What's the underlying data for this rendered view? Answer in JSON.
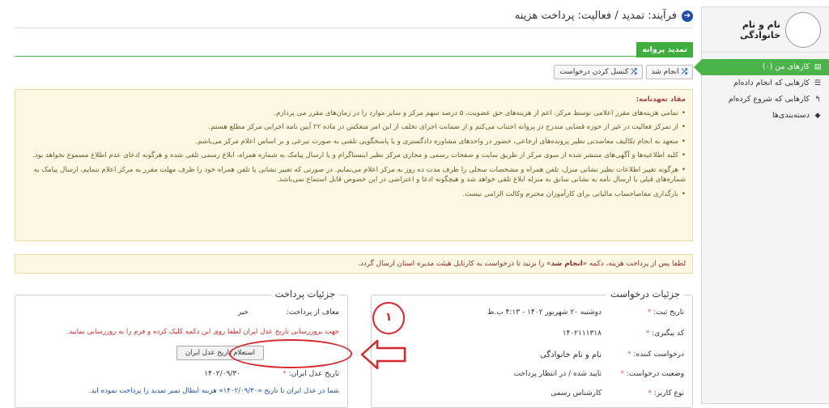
{
  "sidebar": {
    "profile_name": "نام و نام خانوادگی",
    "items": [
      {
        "label": "کارهای من (۰)",
        "icon": "inbox-icon",
        "glyph": "▤"
      },
      {
        "label": "کارهایی که انجام داده‌ام",
        "icon": "list-icon",
        "glyph": "☰"
      },
      {
        "label": "کارهایی که شروع کرده‌ام",
        "icon": "reply-icon",
        "glyph": "↰"
      },
      {
        "label": "دسته‌بندی‌ها",
        "icon": "tag-icon",
        "glyph": "◆"
      }
    ]
  },
  "header": {
    "title": "فرآیند: تمدید / فعالیت: پرداخت هزینه",
    "arrow_glyph": "➔"
  },
  "tab": {
    "label": "تمدید پروانه"
  },
  "toolbar": {
    "done_label": "انجام شد",
    "cancel_label": "کنسل کردن درخواست",
    "icon_glyph": "⤮"
  },
  "commitment": {
    "heading": "مفاد تعهدنامه:",
    "items": [
      "تمامی هزینه‌های مقرر اعلامی توسط مرکز، اعم از هزینه‌های حق عضویت، ۵ درصد سهم مرکز و سایر موارد را در زمان‌های مقرر می پردازم.",
      "از تمرکز فعالیت در غیر از حوزه قضایی مندرج در پروانه اجتناب می‌کنم و از ضمانت اجرای تخلف از این امر منعکس در ماده ۲۲ آیین نامه اجرایی مرکز مطلع هستم.",
      "متعهد به انجام تکالیف معاضدتی نظیر پرونده‌های ارجاعی، حضور در واحدهای مشاوره دادگستری و یا پاسخگویی تلفنی به صورت تبرعی و بر اساس اعلام مرکز می‌باشم.",
      "کلیه اطلاعیه‌ها و آگهی‌های منتشر شده از سوی مرکز از طریق سایت و صفحات رسمی و مجازی مرکز نظیر اینستاگرام و یا ارسال پیامک به شماره همراه، ابلاغ رسمی تلقی شده و هرگونه ادعای عدم اطلاع مسموع نخواهد بود.",
      "هرگونه تغییر اطلاعات نظیر نشانی منزل، تلفن همراه و مشخصات سجلی را ظرف مدت ده روز به مرکز اعلام می‌نمایم. در صورتی که تغییر نشانی یا تلفن همراه خود را ظرف مهلت مقرر به مرکز اعلام ننمایم، ارسال پیامک به شماره‌های قبلی یا ارسال نامه به نشانی سابق به منزله ابلاغ تلقی خواهد شد و هیچگونه ادعا و اعتراضی در این خصوص قابل استماع نمی‌باشد.",
      "بارگذاری مفاصاحساب مالیاتی برای کارآموزان محترم وکالت الزامی نیست."
    ]
  },
  "notice": {
    "before": "لطفا پس از پرداخت هزینه، دکمه «",
    "bold": "انجام شد",
    "after": "» را بزنید تا درخواست به کارتابل هیئت مدیره استان ارسال گردد."
  },
  "request_details": {
    "legend": "جزئیات درخواست",
    "rows": [
      {
        "label": "تاریخ ثبت:",
        "value": "دوشنبه ۲۰ شهریور ۱۴۰۲ - ۴:۱۳ ب.ظ"
      },
      {
        "label": "کد پیگیری:",
        "value": "۱۴۰۲۱۱۱۳۱۸"
      },
      {
        "label": "درخواست کننده:",
        "value": "نام و نام خانوادگی"
      },
      {
        "label": "وضعیت درخواست:",
        "value": "تایید شده / در انتظار پرداخت"
      },
      {
        "label": "نوع کاربر:",
        "value": "کارشناس رسمی"
      }
    ],
    "required_mark": "*"
  },
  "payment_details": {
    "legend": "جزئیات پرداخت",
    "exempt_label": "معاف از پرداخت:",
    "exempt_value": "خیر",
    "update_note": "جهت بروزرسانی تاریخ عدل ایران لطفا روی این دکمه کلیک کرده و فرم را به روزرسانی نمایید.",
    "inquiry_button": "استعلام تاریخ عدل ایران",
    "adl_date_label": "تاریخ عدل ایران:",
    "adl_date_value": "۱۴۰۲/۰۹/۳۰",
    "paid_note": "شما در عدل ایران تا تاریخ «۱۴۰۲/۰۹/۳۰» هزینه ابطال تمبر تمدید را پرداخت نموده اید."
  },
  "annotation": {
    "step_number": "۱"
  },
  "colors": {
    "accent_green": "#3fae3f",
    "warning_bg": "#fcf8e3",
    "annotation_red": "#d9262c"
  }
}
